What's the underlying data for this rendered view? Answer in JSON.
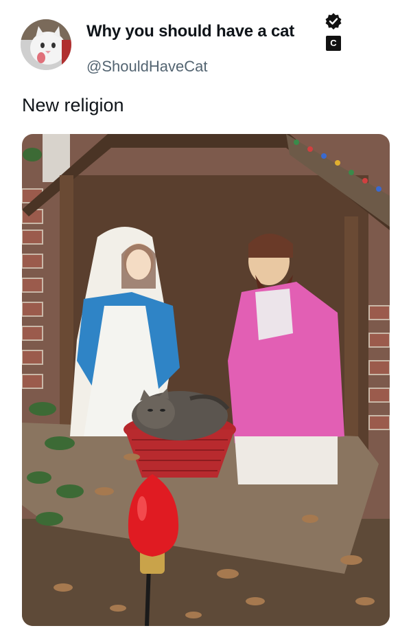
{
  "tweet": {
    "display_name": "Why you should have a cat",
    "handle": "@ShouldHaveCat",
    "affiliate_badge": "C",
    "text": "New religion",
    "verified_icon": "verified-check-icon"
  },
  "colors": {
    "text_primary": "#0f1419",
    "text_secondary": "#536471",
    "background": "#ffffff"
  }
}
